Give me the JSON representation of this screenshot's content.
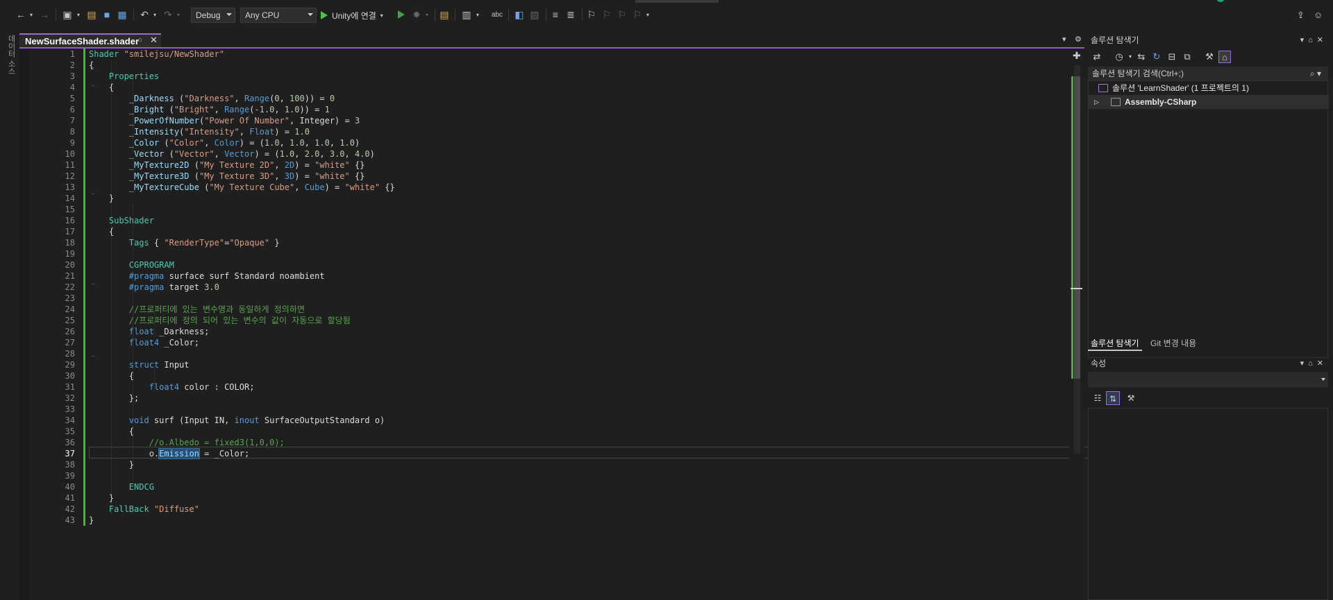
{
  "toolbar": {
    "config": "Debug",
    "platform": "Any CPU",
    "run_label": "Unity에 연결"
  },
  "left_strip": {
    "label": "데이터 소스"
  },
  "editor": {
    "tab_title": "NewSurfaceShader.shader",
    "current_line": 37,
    "line_numbers": [
      "1",
      "2",
      "3",
      "4",
      "5",
      "6",
      "7",
      "8",
      "9",
      "10",
      "11",
      "12",
      "13",
      "14",
      "15",
      "16",
      "17",
      "18",
      "19",
      "20",
      "21",
      "22",
      "23",
      "24",
      "25",
      "26",
      "27",
      "28",
      "29",
      "30",
      "31",
      "32",
      "33",
      "34",
      "35",
      "36",
      "37",
      "38",
      "39",
      "40",
      "41",
      "42",
      "43"
    ]
  },
  "solution_explorer": {
    "title": "솔루션 탐색기",
    "search_placeholder": "솔루션 탐색기 검색(Ctrl+;)",
    "solution_label": "솔루션 'LearnShader' (1 프로젝트의 1)",
    "project_label": "Assembly-CSharp",
    "tab_solution": "솔루션 탐색기",
    "tab_git": "Git 변경 내용"
  },
  "properties_panel": {
    "title": "속성"
  },
  "icons": [
    "back-arrow-icon",
    "forward-arrow-icon",
    "new-project-icon",
    "open-folder-icon",
    "save-icon",
    "save-all-icon",
    "undo-icon",
    "redo-icon",
    "start-without-debug-icon",
    "hot-reload-icon",
    "bookmark-icon",
    "share-icon",
    "feedback-icon",
    "search-icon",
    "wrench-icon",
    "refresh-icon",
    "collapse-all-icon",
    "categorized-icon",
    "alphabetical-icon"
  ]
}
